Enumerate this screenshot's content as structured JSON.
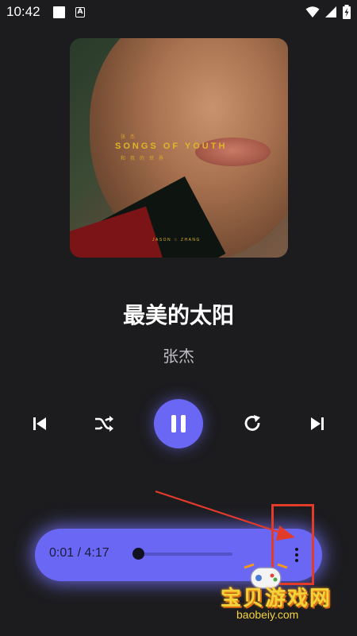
{
  "status_bar": {
    "time": "10:42",
    "notification_a": "A",
    "icons": [
      "square-notification-icon",
      "a-notification-icon",
      "wifi-icon",
      "cell-signal-icon",
      "battery-charging-icon"
    ]
  },
  "album": {
    "title": "SONGS OF YOUTH",
    "credit": "JASON ☆ ZHANG",
    "sub_top": "张  杰",
    "sub_bottom": "和我的世界"
  },
  "song": {
    "title": "最美的太阳",
    "artist": "张杰"
  },
  "controls": {
    "icons": [
      "skip-previous-icon",
      "shuffle-icon",
      "pause-icon",
      "repeat-icon",
      "skip-next-icon"
    ]
  },
  "player": {
    "time_display": "0:01 / 4:17",
    "progress": 0.004,
    "more_icon": "more-vertical-icon"
  },
  "watermark": {
    "brand": "宝贝游戏网",
    "url": "baobeiy.com"
  },
  "colors": {
    "accent": "#6b67f5",
    "background": "#1c1c1f",
    "annotation": "#e23b2a",
    "watermark": "#f3d23a"
  }
}
